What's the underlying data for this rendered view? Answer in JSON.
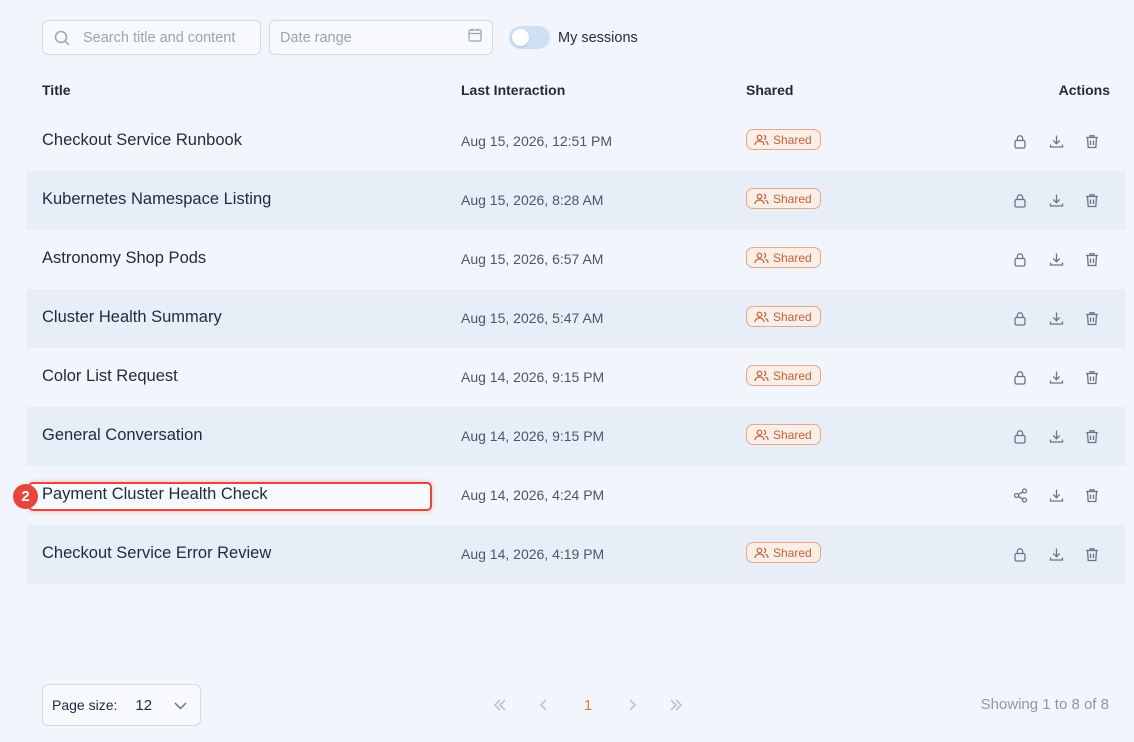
{
  "toolbar": {
    "search_placeholder": "Search title and content",
    "date_placeholder": "Date range",
    "toggle_label": "My sessions",
    "toggle_on": false
  },
  "table": {
    "headers": {
      "title": "Title",
      "last_interaction": "Last Interaction",
      "shared": "Shared",
      "actions": "Actions"
    },
    "rows": [
      {
        "title": "Checkout Service Runbook",
        "date": "Aug 15, 2026, 12:51 PM",
        "shared": "Shared"
      },
      {
        "title": "Kubernetes Namespace Listing",
        "date": "Aug 15, 2026, 8:28 AM",
        "shared": "Shared"
      },
      {
        "title": "Astronomy Shop Pods",
        "date": "Aug 15, 2026, 6:57 AM",
        "shared": "Shared"
      },
      {
        "title": "Cluster Health Summary",
        "date": "Aug 15, 2026, 5:47 AM",
        "shared": "Shared"
      },
      {
        "title": "Color List Request",
        "date": "Aug 14, 2026, 9:15 PM",
        "shared": "Shared"
      },
      {
        "title": "General Conversation",
        "date": "Aug 14, 2026, 9:15 PM",
        "shared": "Shared"
      },
      {
        "title": "Payment Cluster Health Check",
        "date": "Aug 14, 2026, 4:24 PM",
        "shared": ""
      },
      {
        "title": "Checkout Service Error Review",
        "date": "Aug 14, 2026, 4:19 PM",
        "shared": "Shared"
      }
    ]
  },
  "annotation": {
    "step_number": "2"
  },
  "footer": {
    "page_size_label": "Page size:",
    "page_size_value": "12",
    "current_page": "1",
    "showing_text": "Showing 1 to 8 of 8"
  },
  "colors": {
    "accent": "#d9822b",
    "highlight": "#e8453c",
    "badge_text": "#c0623d",
    "row_alt": "#e8eef7",
    "background": "#f2f6fc"
  }
}
